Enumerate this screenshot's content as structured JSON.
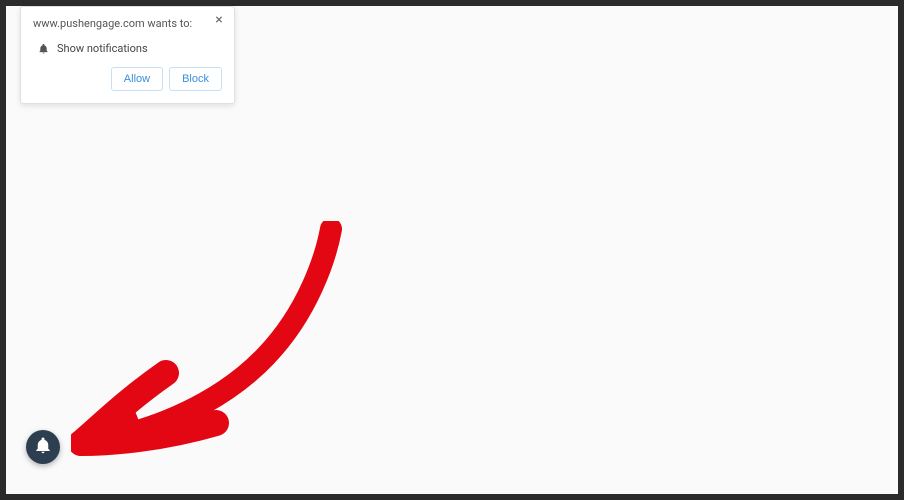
{
  "notification": {
    "domain_text": "www.pushengage.com wants to:",
    "permission_text": "Show notifications",
    "allow_label": "Allow",
    "block_label": "Block",
    "close_label": "×"
  },
  "icons": {
    "bell_small": "bell-icon",
    "bell_floating": "bell-icon"
  },
  "colors": {
    "arrow": "#e30613",
    "floating_bg": "#2c3e50",
    "button_text": "#3b8fde"
  }
}
